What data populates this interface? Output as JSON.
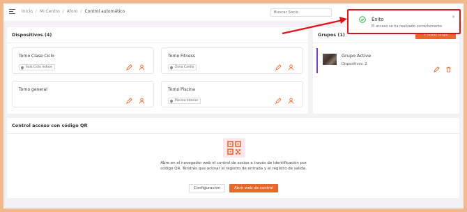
{
  "breadcrumb": {
    "items": [
      "Inicio",
      "Mi Centro",
      "Aforo"
    ],
    "current": "Control automático"
  },
  "search": {
    "placeholder": "Buscar Socio"
  },
  "devices": {
    "title": "Dispositivos (4)",
    "items": [
      {
        "name": "Torno Clase Ciclo",
        "zone": "Sala Ciclo Indoor"
      },
      {
        "name": "Torno Fitness",
        "zone": "Zona Cardio"
      },
      {
        "name": "Torno general",
        "zone": ""
      },
      {
        "name": "Torno Piscina",
        "zone": "Piscina Interior"
      }
    ]
  },
  "groups": {
    "title": "Grupos (1)",
    "add_label": "+ Añadir Grupo",
    "items": [
      {
        "name": "Grupo Active",
        "devices": "Dispositivos: 2"
      }
    ]
  },
  "qr": {
    "title": "Control acceso con código QR",
    "description": "Abre en el navegador web el control de socios a través de identificación por código QR. Tendrás que activar el registro de entrada y el registro de salida.",
    "config_label": "Configuración",
    "open_label": "Abrir web de control"
  },
  "toast": {
    "title": "Éxito",
    "message": "El acceso se ha realizado correctamente",
    "close": "×"
  },
  "colors": {
    "accent": "#e8672a",
    "highlight": "#e0121a",
    "group_bar": "#7b3fd6",
    "success": "#2bb24c",
    "frame": "#f2b98f"
  }
}
